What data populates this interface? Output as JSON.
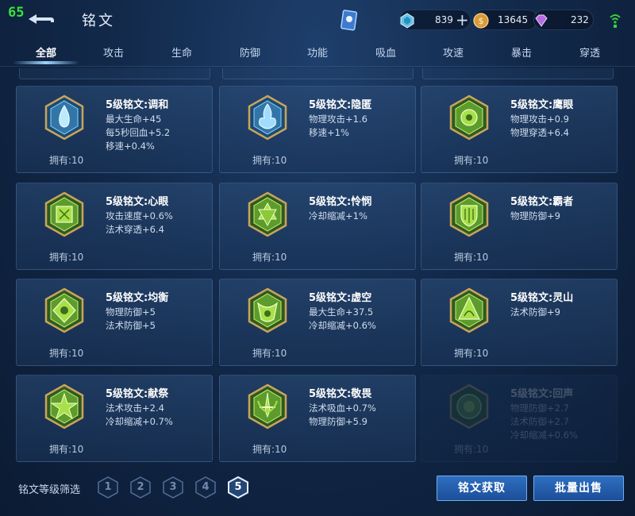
{
  "status": {
    "fps": "65"
  },
  "header": {
    "title": "铭文",
    "resources": [
      {
        "name": "coupon",
        "value": "839"
      },
      {
        "name": "gold",
        "value": "13645"
      },
      {
        "name": "diamond",
        "value": "232"
      }
    ]
  },
  "tabs": [
    {
      "label": "全部"
    },
    {
      "label": "攻击"
    },
    {
      "label": "生命"
    },
    {
      "label": "防御"
    },
    {
      "label": "功能"
    },
    {
      "label": "吸血"
    },
    {
      "label": "攻速"
    },
    {
      "label": "暴击"
    },
    {
      "label": "穿透"
    }
  ],
  "cards": [
    {
      "name": "5级铭文:调和",
      "stats": [
        "最大生命+45",
        "每5秒回血+5.2",
        "移速+0.4%"
      ],
      "owned": "拥有:10",
      "emblem": "blue-teardrop"
    },
    {
      "name": "5级铭文:隐匿",
      "stats": [
        "物理攻击+1.6",
        "移速+1%"
      ],
      "owned": "拥有:10",
      "emblem": "blue-flame"
    },
    {
      "name": "5级铭文:鹰眼",
      "stats": [
        "物理攻击+0.9",
        "物理穿透+6.4"
      ],
      "owned": "拥有:10",
      "emblem": "green-eye"
    },
    {
      "name": "5级铭文:心眼",
      "stats": [
        "攻击速度+0.6%",
        "法术穿透+6.4"
      ],
      "owned": "拥有:10",
      "emblem": "green-square"
    },
    {
      "name": "5级铭文:怜悯",
      "stats": [
        "冷却缩减+1%"
      ],
      "owned": "拥有:10",
      "emblem": "green-hexagram"
    },
    {
      "name": "5级铭文:霸者",
      "stats": [
        "物理防御+9"
      ],
      "owned": "拥有:10",
      "emblem": "green-shield"
    },
    {
      "name": "5级铭文:均衡",
      "stats": [
        "物理防御+5",
        "法术防御+5"
      ],
      "owned": "拥有:10",
      "emblem": "green-balance"
    },
    {
      "name": "5级铭文:虚空",
      "stats": [
        "最大生命+37.5",
        "冷却缩减+0.6%"
      ],
      "owned": "拥有:10",
      "emblem": "green-void"
    },
    {
      "name": "5级铭文:灵山",
      "stats": [
        "法术防御+9"
      ],
      "owned": "拥有:10",
      "emblem": "green-mountain"
    },
    {
      "name": "5级铭文:献祭",
      "stats": [
        "法术攻击+2.4",
        "冷却缩减+0.7%"
      ],
      "owned": "拥有:10",
      "emblem": "green-star"
    },
    {
      "name": "5级铭文:敬畏",
      "stats": [
        "法术吸血+0.7%",
        "物理防御+5.9"
      ],
      "owned": "拥有:10",
      "emblem": "green-sword"
    },
    {
      "name": "5级铭文:回声",
      "stats": [
        "物理防御+2.7",
        "法术防御+2.7",
        "冷却缩减+0.6%"
      ],
      "owned": "拥有:10",
      "emblem": "green-circle"
    }
  ],
  "bottom": {
    "filter_label": "铭文等级筛选",
    "levels": [
      "1",
      "2",
      "3",
      "4",
      "5"
    ],
    "active_level": "5",
    "obtain_button": "铭文获取",
    "sell_button": "批量出售"
  },
  "colors": {
    "accent": "#2f6fc1",
    "fps": "#36e33a"
  }
}
